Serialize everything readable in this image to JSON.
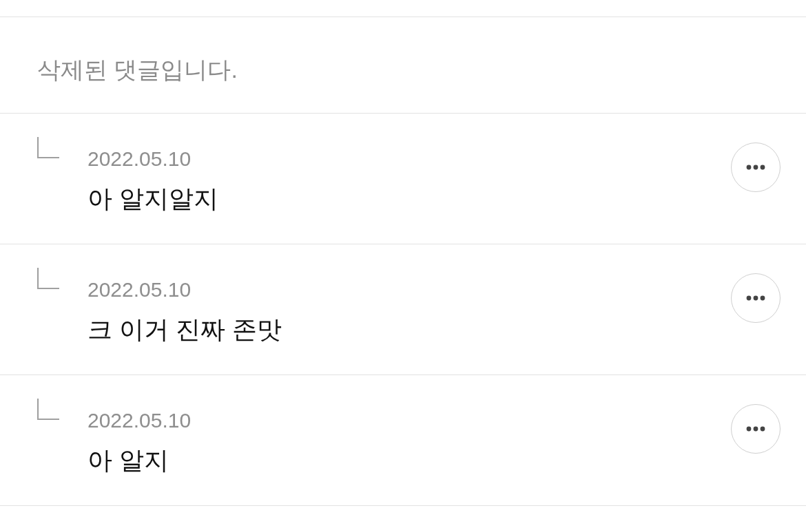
{
  "comment": {
    "deleted": true,
    "text": "삭제된 댓글입니다.",
    "children": [
      {
        "date": "2022.05.10",
        "text": "아 알지알지"
      },
      {
        "date": "2022.05.10",
        "text": "크 이거 진짜 존맛"
      },
      {
        "date": "2022.05.10",
        "text": "아 알지"
      }
    ]
  }
}
